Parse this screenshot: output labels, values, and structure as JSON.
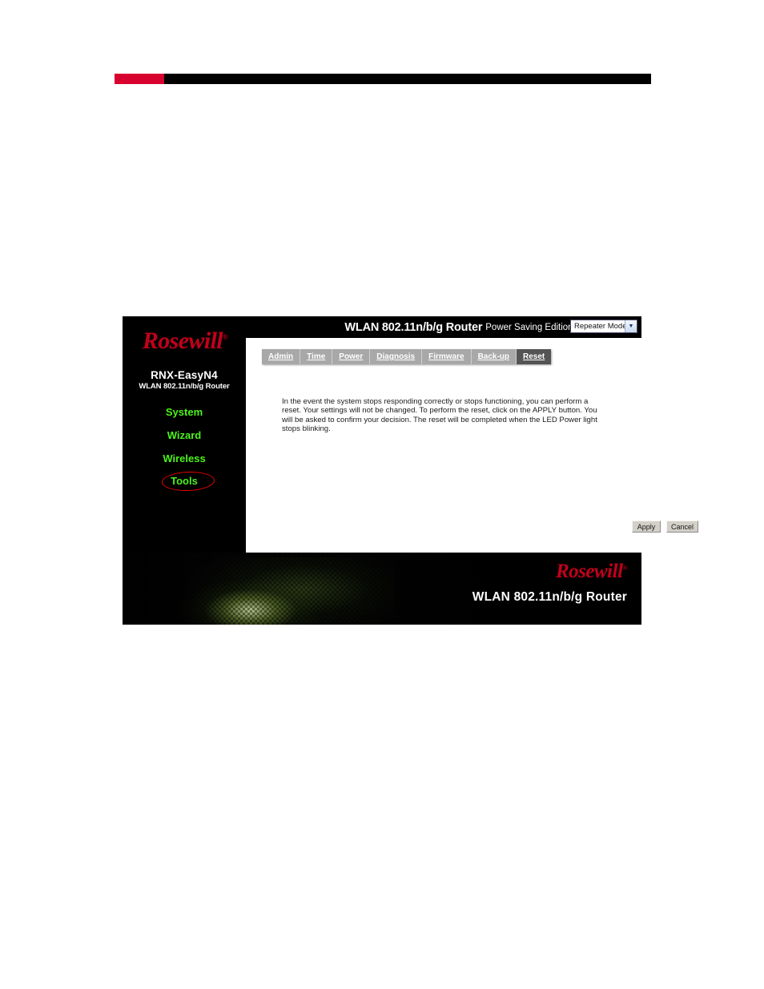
{
  "document": {
    "top_rule_accent_color": "#d8022e",
    "top_rule_color": "#000000"
  },
  "router_ui": {
    "header": {
      "title_main": "WLAN 802.11n/b/g Router",
      "title_sub": "Power Saving Edition",
      "mode_select": {
        "selected": "Repeater Mode",
        "arrow_icon": "chevron-down-icon"
      }
    },
    "sidebar": {
      "brand": "Rosewill",
      "brand_trademark": "®",
      "model_name": "RNX-EasyN4",
      "model_sub": "WLAN 802.11n/b/g Router",
      "accent_color": "#4cf21a",
      "items": [
        {
          "label": "System"
        },
        {
          "label": "Wizard"
        },
        {
          "label": "Wireless"
        },
        {
          "label": "Tools"
        }
      ],
      "annotation": {
        "shape": "ellipse",
        "color": "#ee0000",
        "target": "Tools"
      }
    },
    "tabs": [
      {
        "label": "Admin",
        "active": false
      },
      {
        "label": "Time",
        "active": false
      },
      {
        "label": "Power",
        "active": false
      },
      {
        "label": "Diagnosis",
        "active": false
      },
      {
        "label": "Firmware",
        "active": false
      },
      {
        "label": "Back-up",
        "active": false
      },
      {
        "label": "Reset",
        "active": true
      }
    ],
    "content": {
      "description": "In the event the system stops responding correctly or stops functioning, you can perform a reset. Your settings will not be changed. To perform the reset, click on the APPLY button. You will be asked to confirm your decision. The reset will be completed when the LED Power light stops blinking."
    },
    "buttons": {
      "apply_label": "Apply",
      "cancel_label": "Cancel"
    },
    "footer": {
      "brand": "Rosewill",
      "brand_trademark": "®",
      "tagline": "WLAN 802.11n/b/g Router"
    }
  }
}
